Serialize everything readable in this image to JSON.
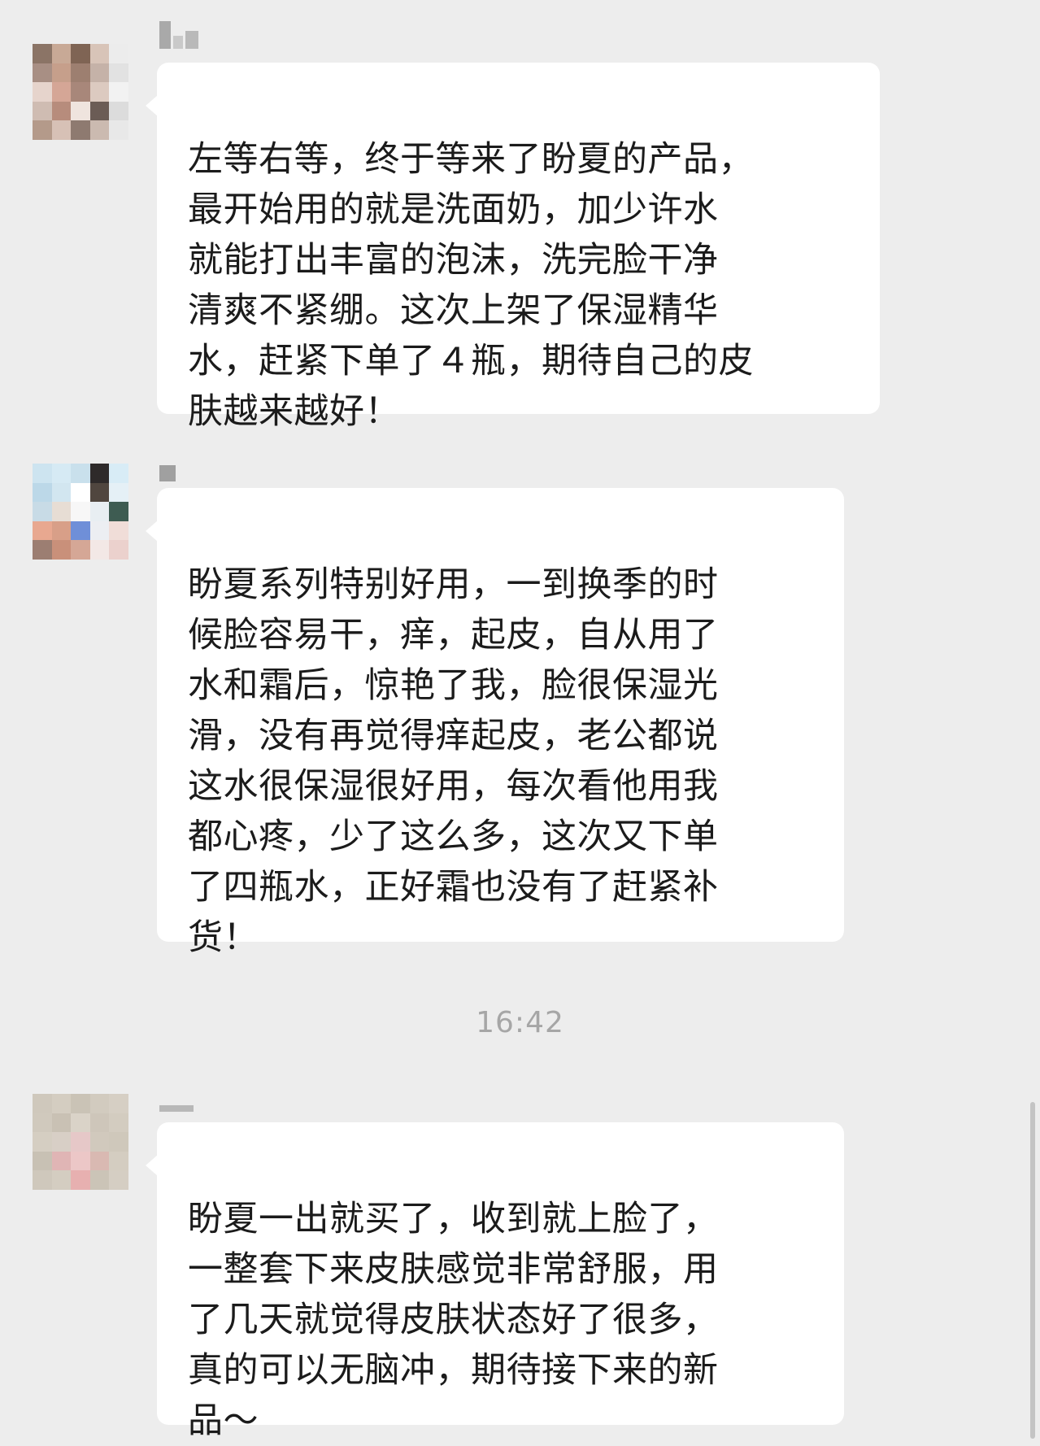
{
  "messages": [
    {
      "text": "左等右等，终于等来了盼夏的产品，\n最开始用的就是洗面奶，加少许水\n就能打出丰富的泡沫，洗完脸干净\n清爽不紧绷。这次上架了保湿精华\n水，赶紧下单了４瓶，期待自己的皮\n肤越来越好！"
    },
    {
      "text": "盼夏系列特别好用，一到换季的时\n候脸容易干，痒，起皮，自从用了\n水和霜后，惊艳了我，脸很保湿光\n滑，没有再觉得痒起皮，老公都说\n这水很保湿很好用，每次看他用我\n都心疼，少了这么多，这次又下单\n了四瓶水，正好霜也没有了赶紧补\n货！"
    },
    {
      "text": "盼夏一出就买了，收到就上脸了，\n一整套下来皮肤感觉非常舒服，用\n了几天就觉得皮肤状态好了很多，\n真的可以无脑冲，期待接下来的新\n品～"
    }
  ],
  "timestamp": "16:42",
  "colors": {
    "background": "#ededed",
    "bubble": "#ffffff",
    "text": "#1b1b1b",
    "timestamp": "#a6a6a6"
  }
}
